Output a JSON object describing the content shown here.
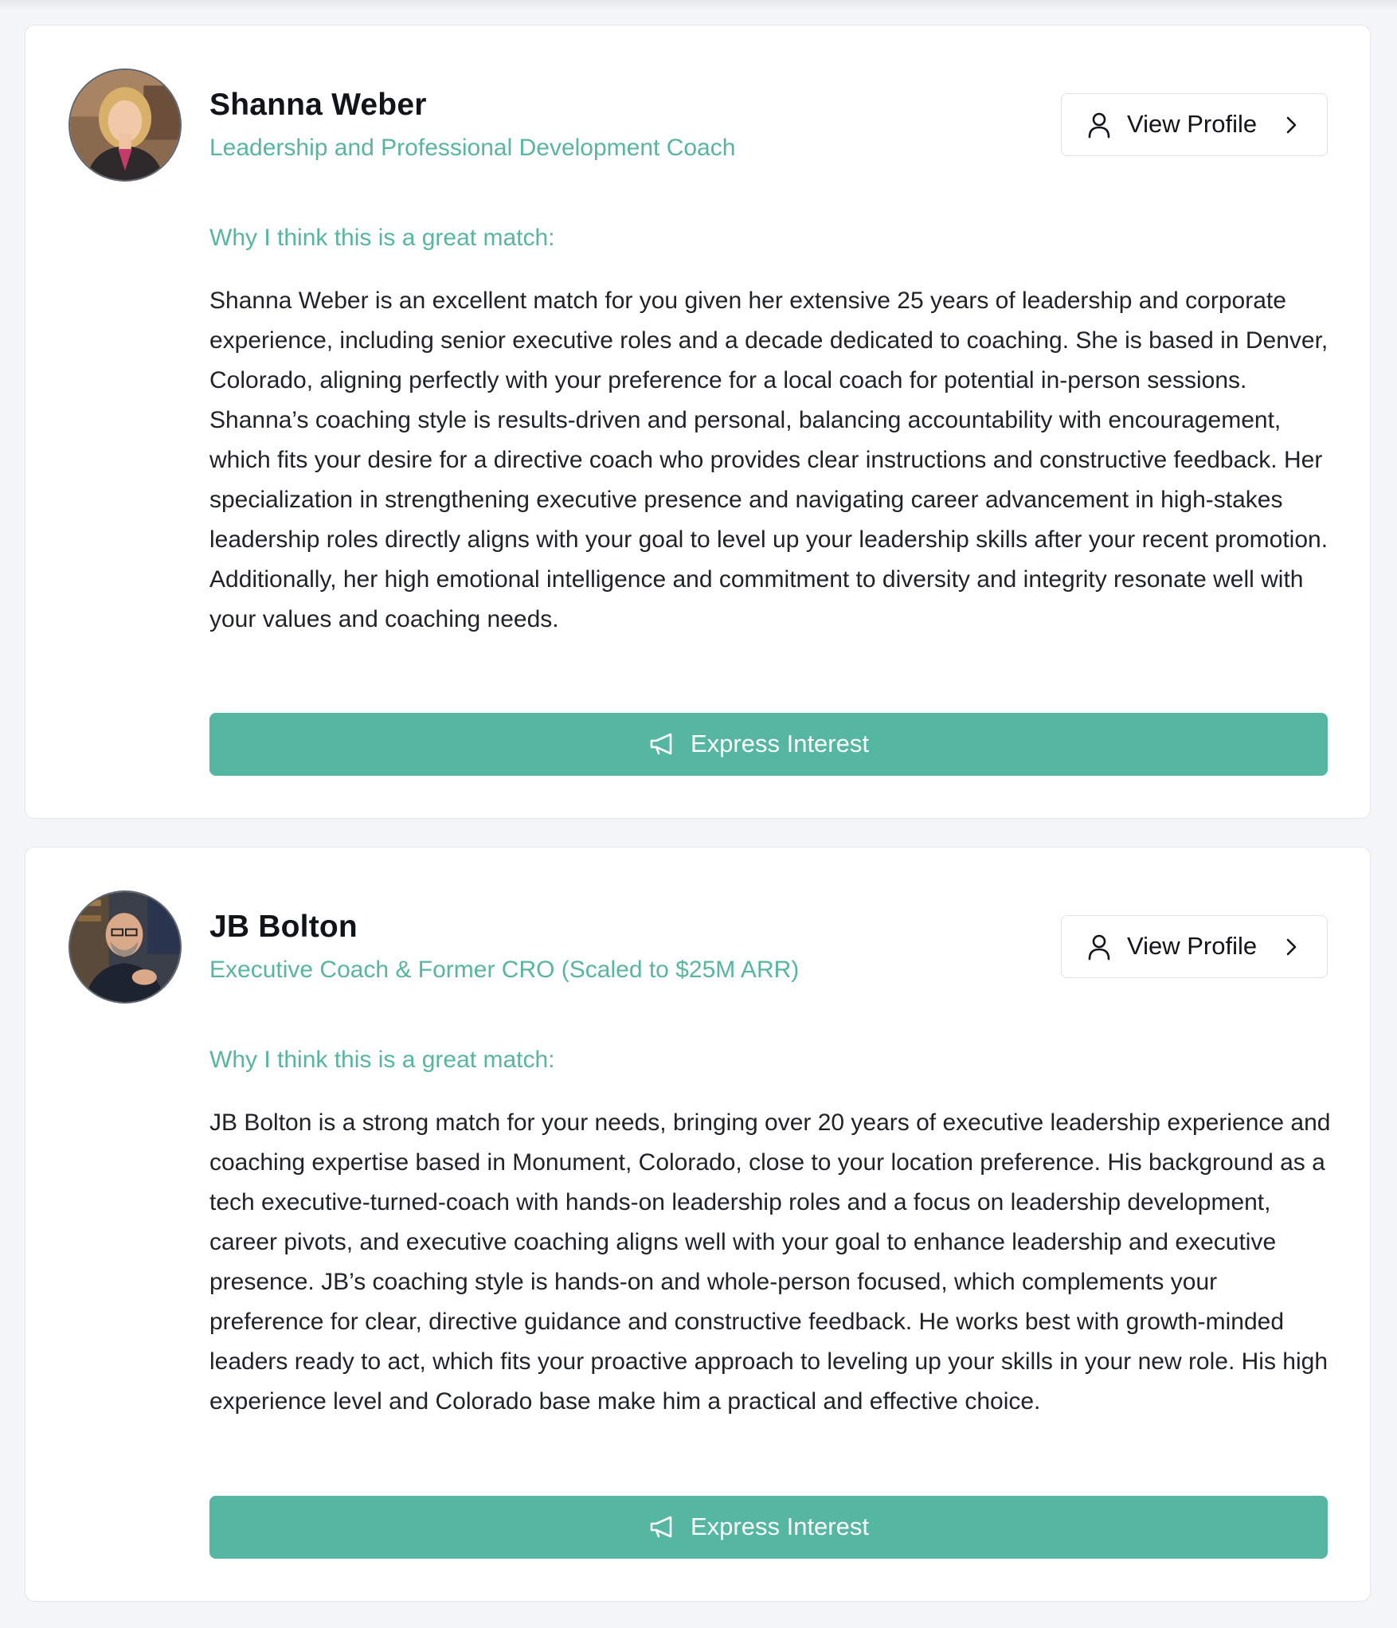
{
  "colors": {
    "accent": "#57b5a0",
    "button": "#55b6a1",
    "text": "#1f2328",
    "background": "#f4f5f7"
  },
  "coaches": [
    {
      "name": "Shanna Weber",
      "title": "Leadership and Professional Development Coach",
      "view_profile_label": "View Profile",
      "match_heading": "Why I think this is a great match:",
      "match_text": "Shanna Weber is an excellent match for you given her extensive 25 years of leadership and corporate experience, including senior executive roles and a decade dedicated to coaching. She is based in Denver, Colorado, aligning perfectly with your preference for a local coach for potential in-person sessions. Shanna’s coaching style is results-driven and personal, balancing accountability with encouragement, which fits your desire for a directive coach who provides clear instructions and constructive feedback. Her specialization in strengthening executive presence and navigating career advancement in high-stakes leadership roles directly aligns with your goal to level up your leadership skills after your recent promotion. Additionally, her high emotional intelligence and commitment to diversity and integrity resonate well with your values and coaching needs.",
      "express_interest_label": "Express Interest"
    },
    {
      "name": "JB Bolton",
      "title": "Executive Coach & Former CRO (Scaled to $25M ARR)",
      "view_profile_label": "View Profile",
      "match_heading": "Why I think this is a great match:",
      "match_text": "JB Bolton is a strong match for your needs, bringing over 20 years of executive leadership experience and coaching expertise based in Monument, Colorado, close to your location preference. His background as a tech executive-turned-coach with hands-on leadership roles and a focus on leadership development, career pivots, and executive coaching aligns well with your goal to enhance leadership and executive presence. JB’s coaching style is hands-on and whole-person focused, which complements your preference for clear, directive guidance and constructive feedback. He works best with growth-minded leaders ready to act, which fits your proactive approach to leveling up your skills in your new role. His high experience level and Colorado base make him a practical and effective choice.",
      "express_interest_label": "Express Interest"
    }
  ],
  "icons": {
    "view_profile": "user-icon",
    "view_profile_arrow": "chevron-right-icon",
    "express_interest": "megaphone-icon"
  }
}
